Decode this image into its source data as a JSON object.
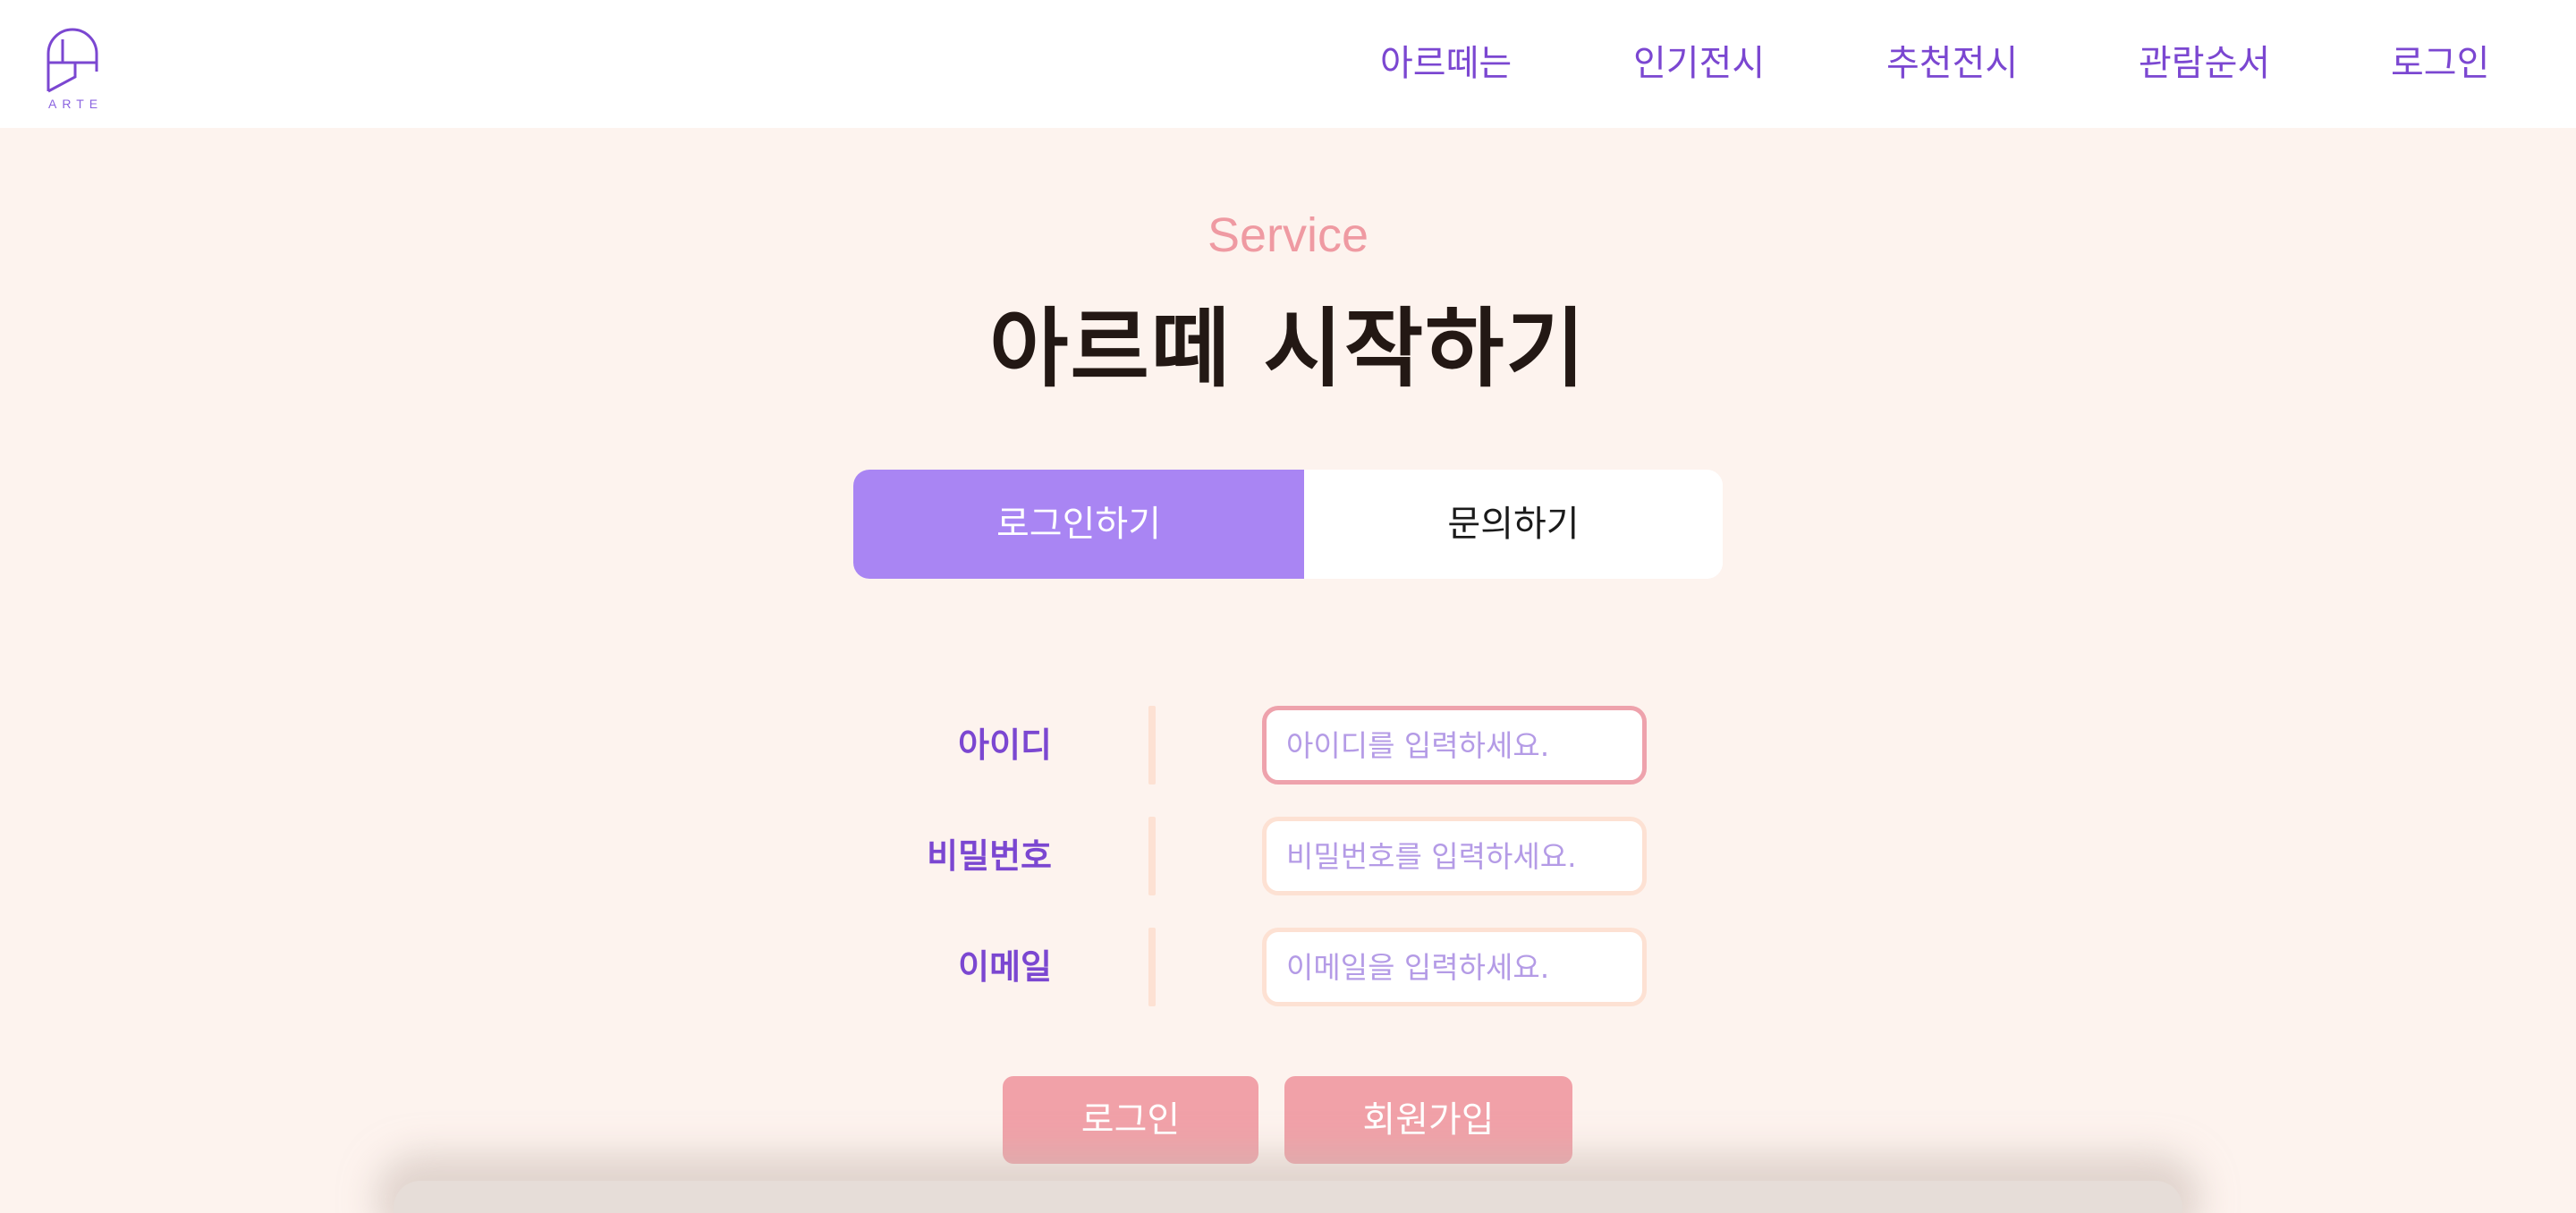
{
  "header": {
    "logo_text": "ARTE",
    "nav": [
      {
        "label": "아르떼는"
      },
      {
        "label": "인기전시"
      },
      {
        "label": "추천전시"
      },
      {
        "label": "관람순서"
      },
      {
        "label": "로그인"
      }
    ]
  },
  "hero": {
    "eyebrow": "Service",
    "title": "아르떼 시작하기"
  },
  "tabs": {
    "login": "로그인하기",
    "inquiry": "문의하기"
  },
  "form": {
    "fields": [
      {
        "label": "아이디",
        "placeholder": "아이디를 입력하세요.",
        "value": ""
      },
      {
        "label": "비밀번호",
        "placeholder": "비밀번호를 입력하세요.",
        "value": ""
      },
      {
        "label": "이메일",
        "placeholder": "이메일을 입력하세요.",
        "value": ""
      }
    ]
  },
  "buttons": {
    "login": "로그인",
    "signup": "회원가입"
  },
  "colors": {
    "accent_purple": "#7b47d1",
    "tab_active": "#a985f3",
    "button_pink": "#f1a1a8",
    "eyebrow_pink": "#ef9aa2",
    "background": "#fdf3ee"
  }
}
